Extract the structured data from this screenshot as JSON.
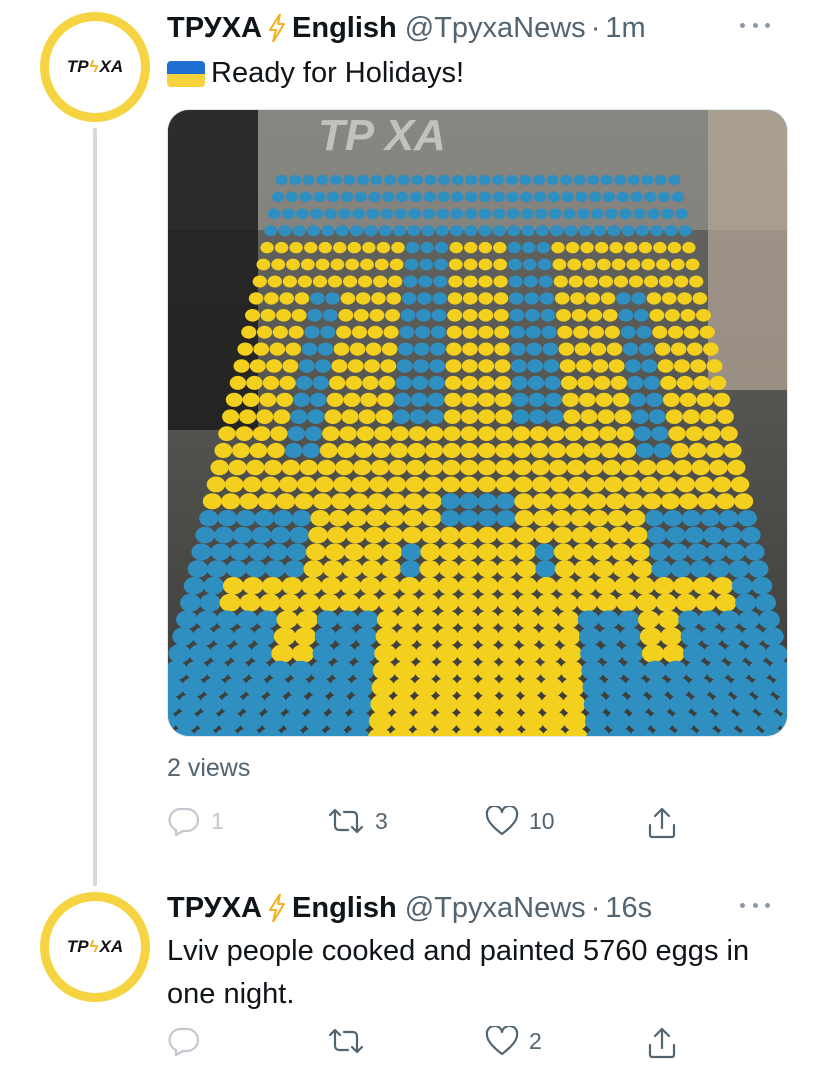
{
  "tweets": [
    {
      "avatar": {
        "text_left": "ТР",
        "text_right": "ХА"
      },
      "display_name": "ТРУХА",
      "name_suffix": "English",
      "handle": "@TpyxaNews",
      "separator": "·",
      "time": "1m",
      "text": "Ready for Holidays!",
      "flag": "ukraine-flag",
      "watermark": "TP  XA",
      "views": "2 views",
      "actions": {
        "reply": "1",
        "retweet": "3",
        "like": "10"
      }
    },
    {
      "avatar": {
        "text_left": "ТР",
        "text_right": "ХА"
      },
      "display_name": "ТРУХА",
      "name_suffix": "English",
      "handle": "@TpyxaNews",
      "separator": "·",
      "time": "16s",
      "text": "Lviv people cooked and painted 5760 eggs in one night.",
      "actions": {
        "reply": "",
        "retweet": "",
        "like": "2"
      }
    }
  ],
  "colors": {
    "brand_yellow": "#f6d341",
    "bolt": "#f2b21c",
    "muted": "#536471",
    "egg_blue": "#2f8fc0",
    "egg_yellow": "#f3cf1e"
  }
}
